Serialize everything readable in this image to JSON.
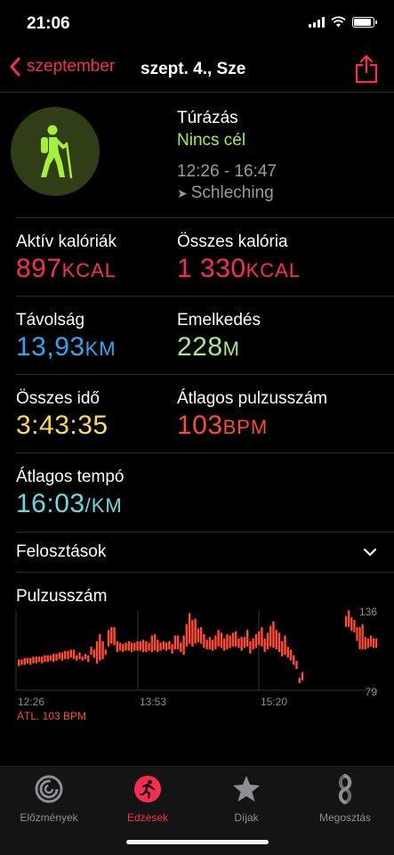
{
  "status_bar": {
    "time": "21:06"
  },
  "nav": {
    "back_label": "szeptember",
    "title": "szept. 4., Sze"
  },
  "workout": {
    "type": "Túrázás",
    "goal": "Nincs cél",
    "time_range": "12:26 - 16:47",
    "location": "Schleching",
    "icon": "hiking-figure-icon"
  },
  "metrics": {
    "active_cal": {
      "label": "Aktív kalóriák",
      "value": "897",
      "unit": "KCAL"
    },
    "total_cal": {
      "label": "Összes kalória",
      "value": "1 330",
      "unit": "KCAL"
    },
    "distance": {
      "label": "Távolság",
      "value": "13,93",
      "unit": "KM"
    },
    "elevation": {
      "label": "Emelkedés",
      "value": "228",
      "unit": "M"
    },
    "total_time": {
      "label": "Összes idő",
      "value": "3:43:35"
    },
    "avg_hr": {
      "label": "Átlagos pulzusszám",
      "value": "103",
      "unit": "BPM"
    },
    "avg_pace": {
      "label": "Átlagos tempó",
      "value": "16:03",
      "unit": "/KM"
    }
  },
  "splits": {
    "label": "Felosztások"
  },
  "heart_rate": {
    "label": "Pulzusszám",
    "avg_label": "ÁTL. 103 BPM"
  },
  "colors": {
    "accent": "#fa2c4f",
    "active_cal": "#fa2d55",
    "distance": "#2ea6f6",
    "elevation": "#a4e98e",
    "time": "#fbdf42",
    "heart_rate": "#ff4b30",
    "pace": "#62dde1",
    "goal": "#a6f03a"
  },
  "chart_data": {
    "type": "bar",
    "title": "Pulzusszám",
    "x_ticks": [
      "12:26",
      "13:53",
      "15:20"
    ],
    "y_ticks": [
      136,
      79
    ],
    "ylim": [
      79,
      136
    ],
    "average": 103,
    "average_label": "ÁTL. 103 BPM",
    "series": [
      {
        "values": [
          [
            96,
            101
          ],
          [
            97,
            101
          ],
          [
            97,
            102
          ],
          [
            98,
            102
          ],
          [
            97,
            102
          ],
          [
            98,
            103
          ],
          [
            98,
            103
          ],
          [
            99,
            103
          ],
          [
            98,
            103
          ],
          [
            99,
            104
          ],
          [
            99,
            104
          ],
          [
            100,
            104
          ],
          [
            99,
            105
          ],
          [
            100,
            105
          ],
          [
            101,
            106
          ],
          [
            100,
            106
          ],
          [
            101,
            107
          ],
          [
            101,
            107
          ],
          [
            102,
            108
          ],
          [
            101,
            108
          ],
          [
            100,
            104
          ],
          [
            101,
            106
          ],
          [
            100,
            103
          ],
          [
            101,
            105
          ],
          [
            99,
            104
          ],
          [
            104,
            110
          ],
          [
            102,
            108
          ],
          [
            98,
            114
          ],
          [
            100,
            119
          ],
          [
            101,
            114
          ],
          [
            104,
            108
          ],
          [
            110,
            122
          ],
          [
            112,
            124
          ],
          [
            111,
            124
          ],
          [
            106,
            114
          ],
          [
            107,
            113
          ],
          [
            106,
            112
          ],
          [
            107,
            113
          ],
          [
            107,
            114
          ],
          [
            106,
            113
          ],
          [
            107,
            113
          ],
          [
            107,
            114
          ],
          [
            107,
            114
          ],
          [
            106,
            115
          ],
          [
            106,
            114
          ],
          [
            107,
            113
          ],
          [
            106,
            118
          ],
          [
            107,
            119
          ],
          [
            106,
            115
          ],
          [
            107,
            113
          ],
          [
            108,
            114
          ],
          [
            107,
            113
          ],
          [
            108,
            114
          ],
          [
            105,
            112
          ],
          [
            108,
            118
          ],
          [
            108,
            118
          ],
          [
            106,
            113
          ],
          [
            104,
            118
          ],
          [
            110,
            126
          ],
          [
            112,
            134
          ],
          [
            110,
            129
          ],
          [
            112,
            130
          ],
          [
            113,
            123
          ],
          [
            112,
            124
          ],
          [
            109,
            119
          ],
          [
            108,
            115
          ],
          [
            108,
            117
          ],
          [
            107,
            115
          ],
          [
            108,
            118
          ],
          [
            110,
            122
          ],
          [
            109,
            120
          ],
          [
            107,
            116
          ],
          [
            108,
            119
          ],
          [
            109,
            118
          ],
          [
            110,
            120
          ],
          [
            110,
            121
          ],
          [
            109,
            116
          ],
          [
            107,
            117
          ],
          [
            109,
            117
          ],
          [
            110,
            122
          ],
          [
            105,
            114
          ],
          [
            108,
            116
          ],
          [
            109,
            119
          ],
          [
            111,
            121
          ],
          [
            110,
            124
          ],
          [
            106,
            116
          ],
          [
            108,
            120
          ],
          [
            110,
            125
          ],
          [
            109,
            128
          ],
          [
            108,
            122
          ],
          [
            106,
            120
          ],
          [
            103,
            114
          ],
          [
            104,
            118
          ],
          [
            102,
            110
          ],
          [
            100,
            108
          ],
          [
            97,
            104
          ],
          [
            94,
            100
          ],
          [
            84,
            88
          ],
          [
            86,
            92
          ]
        ]
      },
      {
        "values": [
          [
            124,
            132
          ],
          [
            124,
            136
          ],
          [
            121,
            131
          ],
          [
            120,
            129
          ],
          [
            114,
            124
          ],
          [
            108,
            124
          ],
          [
            108,
            126
          ],
          [
            108,
            117
          ],
          [
            109,
            116
          ],
          [
            110,
            118
          ],
          [
            109,
            116
          ],
          [
            109,
            116
          ]
        ]
      }
    ]
  },
  "tabs": [
    {
      "label": "Előzmények",
      "icon": "history-rings-icon"
    },
    {
      "label": "Edzések",
      "icon": "workouts-runner-icon"
    },
    {
      "label": "Díjak",
      "icon": "awards-star-icon"
    },
    {
      "label": "Megosztás",
      "icon": "sharing-icon"
    }
  ]
}
